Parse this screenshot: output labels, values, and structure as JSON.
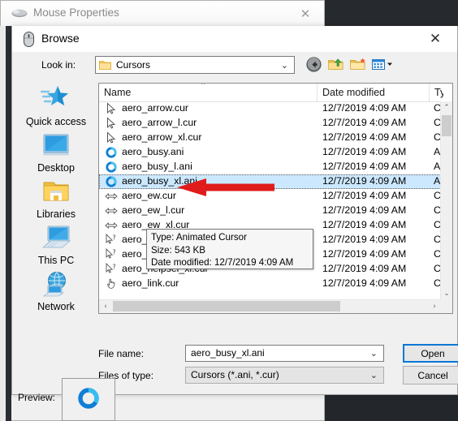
{
  "mouse_properties": {
    "title": "Mouse Properties",
    "icon": "mouse-icon",
    "close_label": "✕",
    "preview_label": "Preview:",
    "preview_icon": "busy-ring-cursor-icon"
  },
  "browse_dialog": {
    "title": "Browse",
    "icon": "mouse-icon",
    "close_label": "✕",
    "lookin": {
      "label": "Look in:",
      "value": "Cursors",
      "chevron": "⌄",
      "folder_icon": "folder-icon"
    },
    "toolbar": [
      {
        "name": "back-button",
        "icon": "back-arrow-icon"
      },
      {
        "name": "up-one-level-button",
        "icon": "up-folder-icon"
      },
      {
        "name": "new-folder-button",
        "icon": "new-folder-icon"
      },
      {
        "name": "views-button",
        "icon": "views-grid-icon"
      }
    ],
    "places": [
      {
        "label": "Quick access",
        "icon": "quick-access-star-icon"
      },
      {
        "label": "Desktop",
        "icon": "desktop-monitor-icon"
      },
      {
        "label": "Libraries",
        "icon": "libraries-folder-icon"
      },
      {
        "label": "This PC",
        "icon": "this-pc-icon"
      },
      {
        "label": "Network",
        "icon": "network-globe-icon"
      }
    ],
    "columns": [
      "Name",
      "Date modified",
      "Ty"
    ],
    "sort_caret": "⌃",
    "files": [
      {
        "name": "aero_arrow.cur",
        "date": "12/7/2019 4:09 AM",
        "type": "Cu",
        "icon": "arrow-cursor-icon",
        "selected": false
      },
      {
        "name": "aero_arrow_l.cur",
        "date": "12/7/2019 4:09 AM",
        "type": "Cu",
        "icon": "arrow-cursor-icon",
        "selected": false
      },
      {
        "name": "aero_arrow_xl.cur",
        "date": "12/7/2019 4:09 AM",
        "type": "Cu",
        "icon": "arrow-cursor-icon",
        "selected": false
      },
      {
        "name": "aero_busy.ani",
        "date": "12/7/2019 4:09 AM",
        "type": "An",
        "icon": "busy-ring-cursor-icon",
        "selected": false
      },
      {
        "name": "aero_busy_l.ani",
        "date": "12/7/2019 4:09 AM",
        "type": "An",
        "icon": "busy-ring-cursor-icon",
        "selected": false
      },
      {
        "name": "aero_busy_xl.ani",
        "date": "12/7/2019 4:09 AM",
        "type": "An",
        "icon": "busy-ring-cursor-icon",
        "selected": true
      },
      {
        "name": "aero_ew.cur",
        "date": "12/7/2019 4:09 AM",
        "type": "Cu",
        "icon": "resize-ew-cursor-icon",
        "selected": false
      },
      {
        "name": "aero_ew_l.cur",
        "date": "12/7/2019 4:09 AM",
        "type": "Cu",
        "icon": "resize-ew-cursor-icon",
        "selected": false
      },
      {
        "name": "aero_ew_xl.cur",
        "date": "12/7/2019 4:09 AM",
        "type": "Cu",
        "icon": "resize-ew-cursor-icon",
        "selected": false
      },
      {
        "name": "aero_helpsel.cur",
        "date": "12/7/2019 4:09 AM",
        "type": "Cu",
        "icon": "help-select-cursor-icon",
        "selected": false
      },
      {
        "name": "aero_helpsel_l.cur",
        "date": "12/7/2019 4:09 AM",
        "type": "Cu",
        "icon": "help-select-cursor-icon",
        "selected": false
      },
      {
        "name": "aero_helpsel_xl.cur",
        "date": "12/7/2019 4:09 AM",
        "type": "Cu",
        "icon": "help-select-cursor-icon",
        "selected": false
      },
      {
        "name": "aero_link.cur",
        "date": "12/7/2019 4:09 AM",
        "type": "Cu",
        "icon": "link-hand-cursor-icon",
        "selected": false
      }
    ],
    "tooltip": {
      "line1": "Type: Animated Cursor",
      "line2": "Size: 543 KB",
      "line3": "Date modified: 12/7/2019 4:09 AM"
    },
    "file_name": {
      "label": "File name:",
      "value": "aero_busy_xl.ani",
      "chevron": "⌄"
    },
    "files_of_type": {
      "label": "Files of type:",
      "value": "Cursors (*.ani, *.cur)",
      "chevron": "⌄"
    },
    "buttons": {
      "open": "Open",
      "cancel": "Cancel"
    },
    "scrollbars": {
      "up": "⌃",
      "down": "⌄",
      "left": "‹",
      "right": "›"
    }
  },
  "annotation": {
    "type": "red-arrow-left",
    "color": "#e01b1b"
  },
  "colors": {
    "selection": "#cce8ff",
    "accent": "#0078d7",
    "window_bg": "#f0f0f0",
    "desktop": "#26292d"
  }
}
